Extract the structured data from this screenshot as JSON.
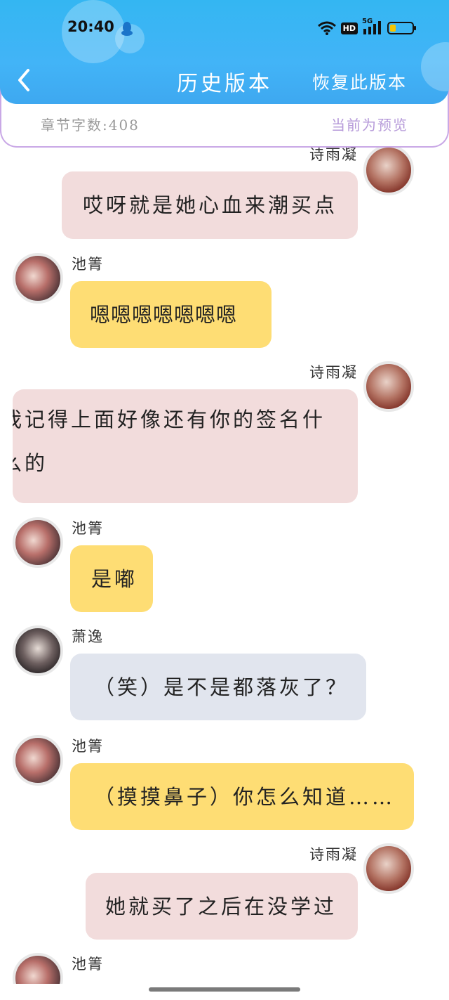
{
  "status_bar": {
    "time": "20:40",
    "hd_badge": "HD",
    "network": "5G"
  },
  "nav": {
    "title": "历史版本",
    "restore_label": "恢复此版本"
  },
  "info": {
    "word_count": "章节字数:408",
    "preview_label": "当前为预览"
  },
  "messages": [
    {
      "sender": "诗雨凝",
      "side": "right",
      "text": "哎呀就是她心血来潮买点"
    },
    {
      "sender": "池箐",
      "side": "left",
      "text": "嗯嗯嗯嗯嗯嗯嗯"
    },
    {
      "sender": "诗雨凝",
      "side": "right",
      "line1": "我记得上面好像还有你的签名什",
      "line2": "么的"
    },
    {
      "sender": "池箐",
      "side": "left",
      "text": "是嘟"
    },
    {
      "sender": "萧逸",
      "side": "left",
      "text": "（笑）是不是都落灰了？"
    },
    {
      "sender": "池箐",
      "side": "left",
      "text": "（摸摸鼻子）你怎么知道……"
    },
    {
      "sender": "诗雨凝",
      "side": "right",
      "text": "她就买了之后在没学过"
    },
    {
      "sender": "池箐",
      "side": "left",
      "text": ""
    }
  ],
  "colors": {
    "header_blue": "#3eb2f4",
    "panel_border": "#c9a8e6",
    "bubble_pink": "#f2dcdc",
    "bubble_yellow": "#fedd74",
    "bubble_grey": "#e1e5ee"
  }
}
